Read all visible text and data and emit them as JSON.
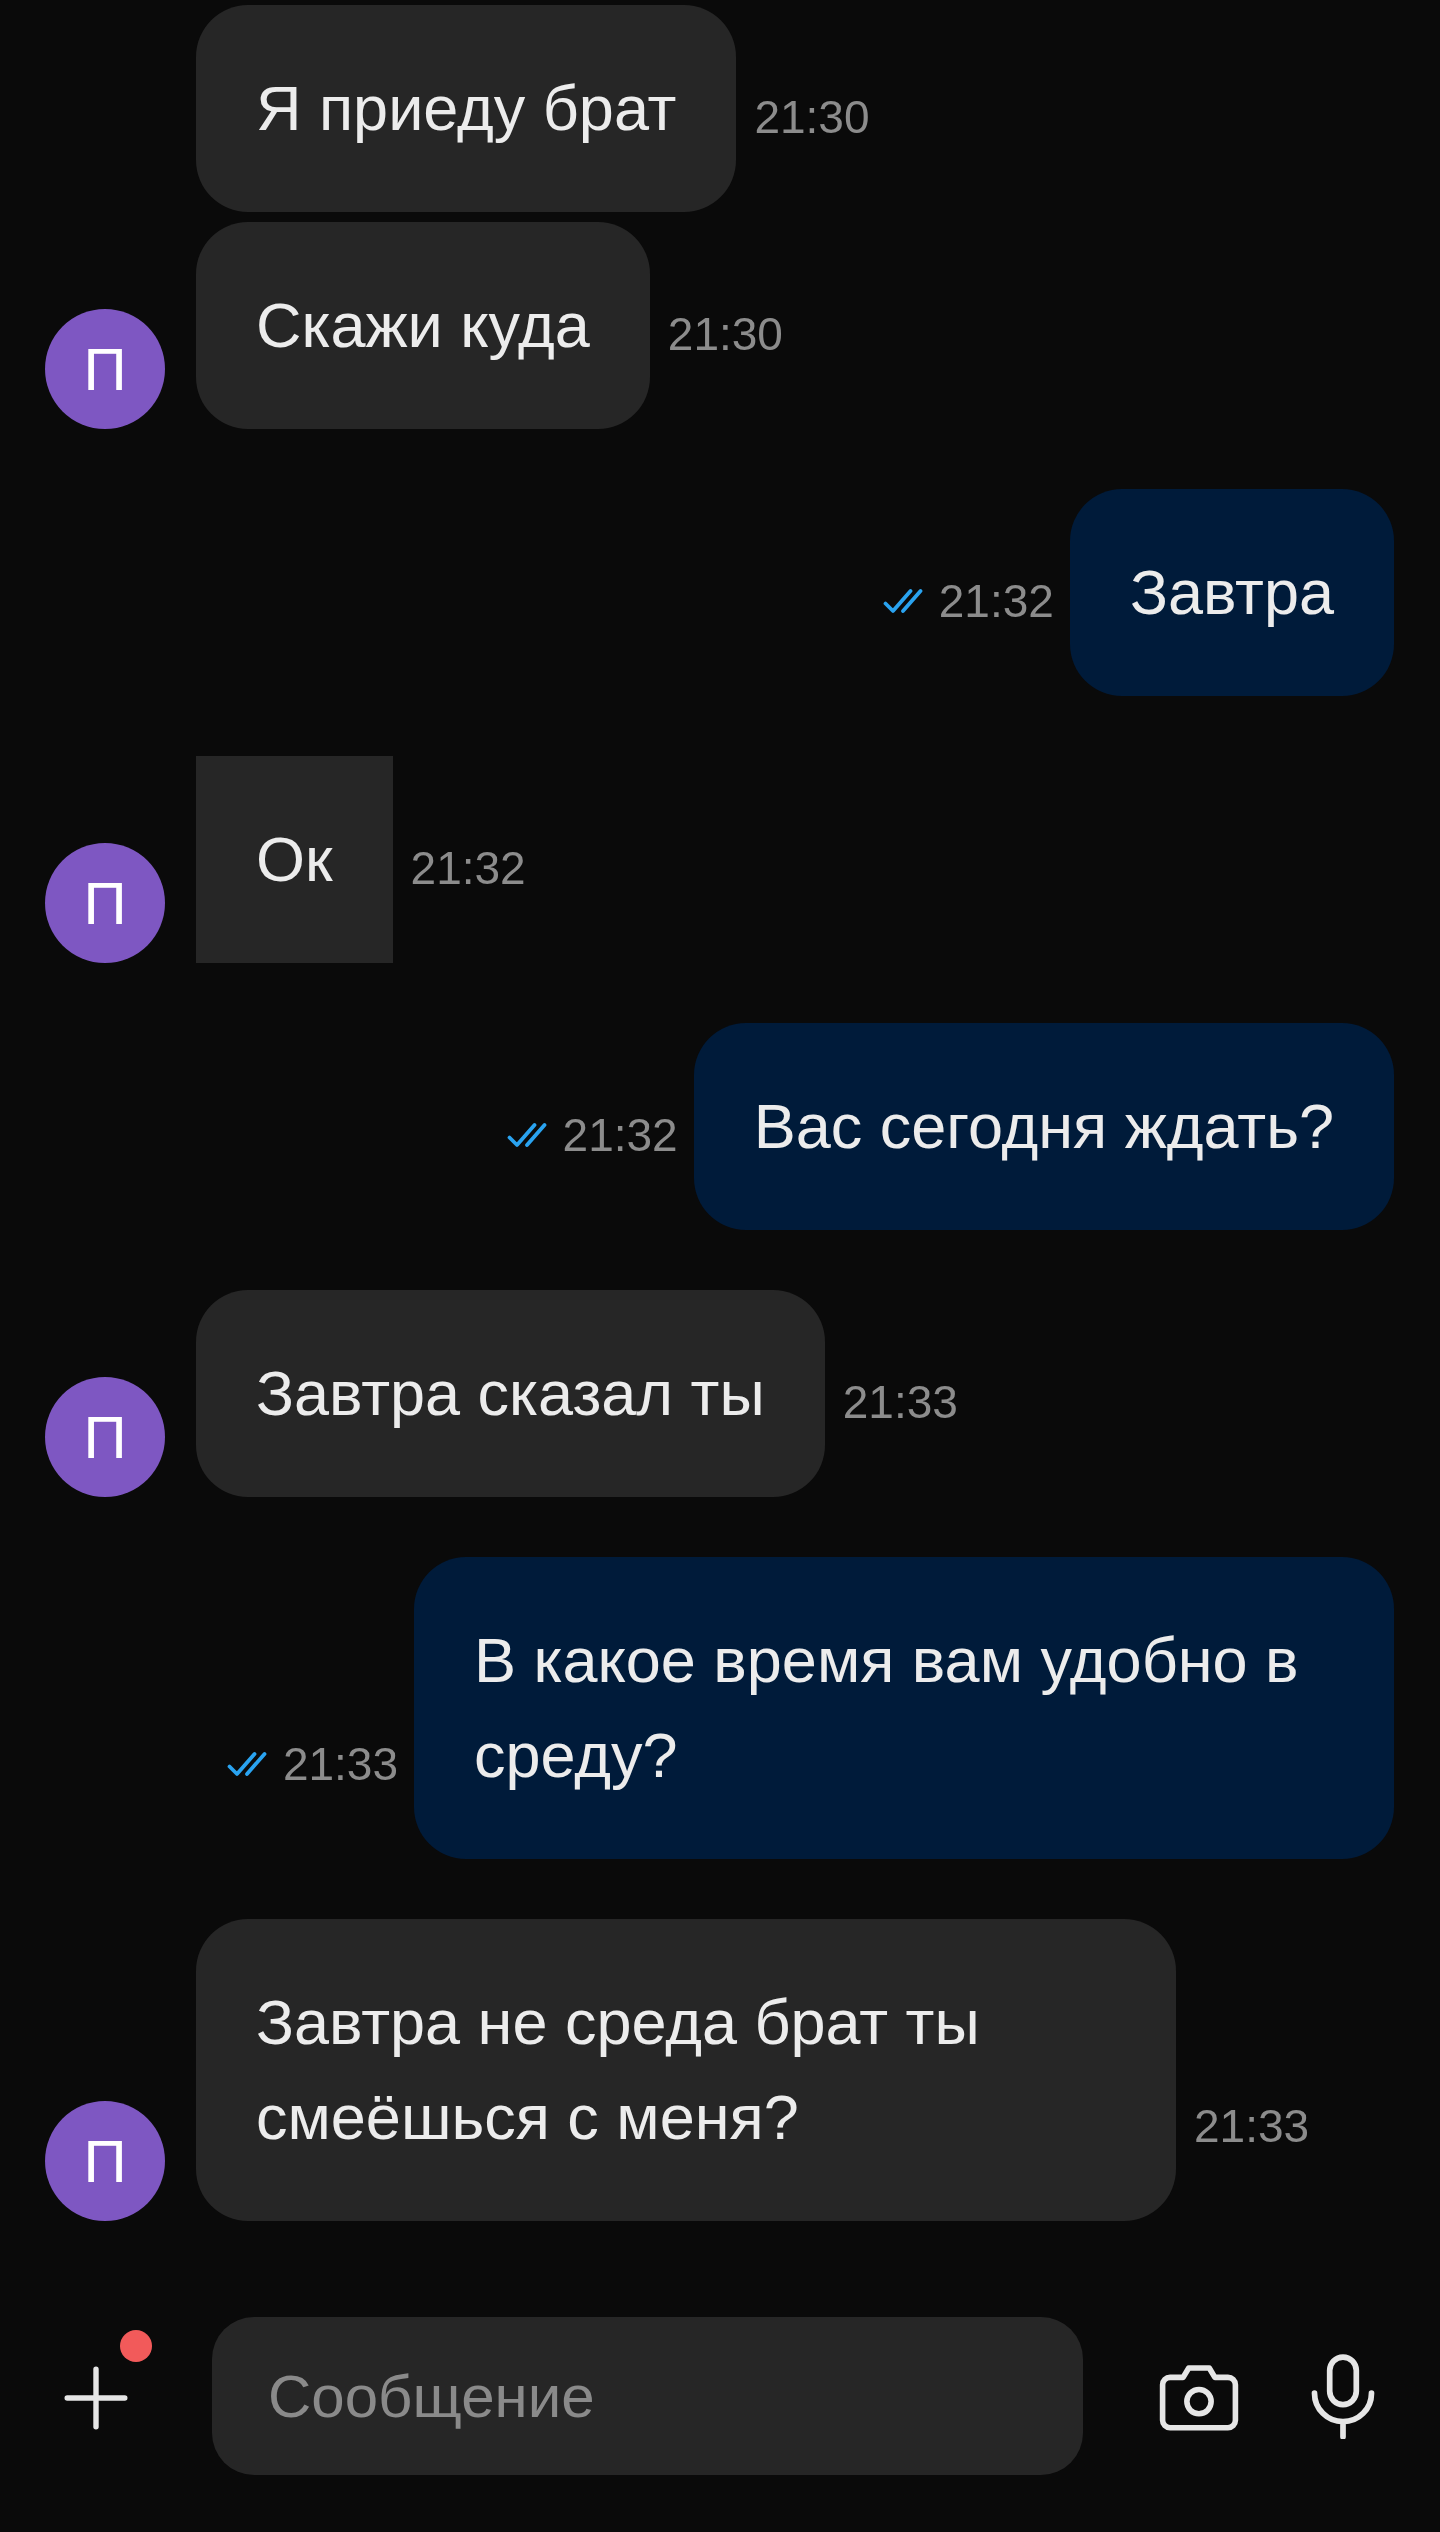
{
  "messages": [
    {
      "text": "Я приеду брат",
      "time": "21:30",
      "outgoing": false,
      "square": false
    },
    {
      "text": "Скажи куда",
      "time": "21:30",
      "outgoing": false,
      "square": false,
      "avatar": "П"
    },
    {
      "text": "Завтра",
      "time": "21:32",
      "outgoing": true,
      "square": false,
      "read": true
    },
    {
      "text": "Ок",
      "time": "21:32",
      "outgoing": false,
      "square": true,
      "avatar": "П"
    },
    {
      "text": "Вас сегодня ждать?",
      "time": "21:32",
      "outgoing": true,
      "square": false,
      "read": true
    },
    {
      "text": "Завтра сказал ты",
      "time": "21:33",
      "outgoing": false,
      "square": false,
      "avatar": "П"
    },
    {
      "text": "В какое время вам удобно в среду?",
      "time": "21:33",
      "outgoing": true,
      "square": false,
      "read": true
    },
    {
      "text": "Завтра не среда брат ты смеёшься с меня?",
      "time": "21:33",
      "outgoing": false,
      "square": false,
      "avatar": "П"
    }
  ],
  "composer": {
    "placeholder": "Сообщение",
    "attach_badge": true
  }
}
